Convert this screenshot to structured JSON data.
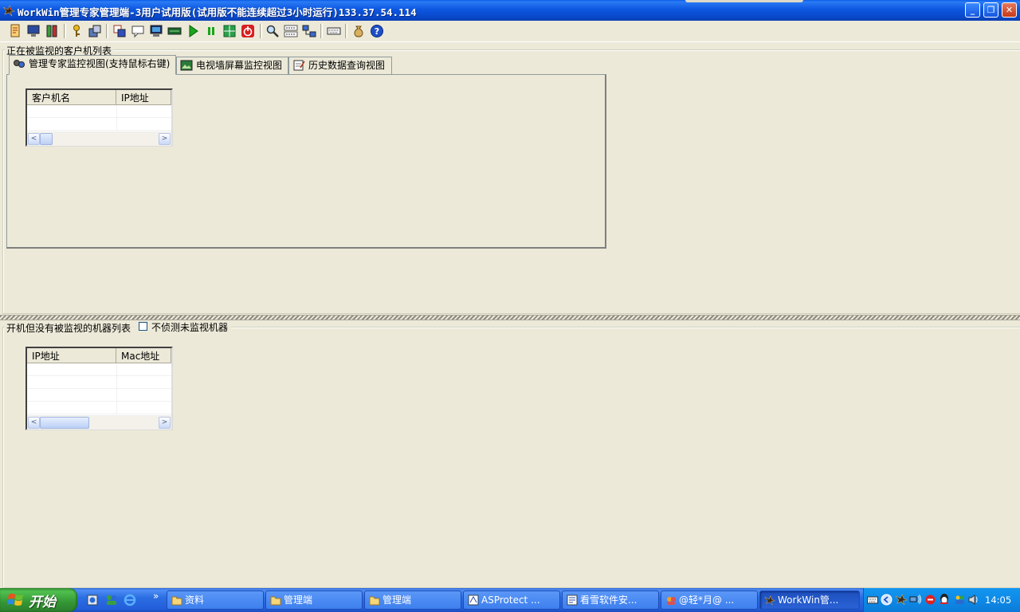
{
  "window": {
    "title": "WorkWin管理专家管理端-3用户试用版(试用版不能连续超过3小时运行)133.37.54.114",
    "controls": {
      "minimize": "_",
      "maximize": "❐",
      "close": "✕"
    }
  },
  "toolbar": {
    "buttons": [
      {
        "icon": "report-icon"
      },
      {
        "icon": "monitor-icon"
      },
      {
        "icon": "users-icon"
      },
      {
        "icon": "key-icon"
      },
      {
        "icon": "settings-icon"
      },
      {
        "icon": "copy-icon"
      },
      {
        "icon": "message-icon"
      },
      {
        "icon": "screen-icon"
      },
      {
        "icon": "device-icon"
      },
      {
        "icon": "play-icon"
      },
      {
        "icon": "pause-icon"
      },
      {
        "icon": "grid-icon"
      },
      {
        "icon": "power-icon"
      },
      {
        "icon": "search-icon"
      },
      {
        "icon": "mac-icon"
      },
      {
        "icon": "network-icon"
      },
      {
        "icon": "keyboard-icon"
      },
      {
        "icon": "money-bag-icon"
      },
      {
        "icon": "help-icon"
      }
    ],
    "colors": {
      "play": "#1aa51a",
      "power": "#d81e1e",
      "help": "#1f4fc7"
    }
  },
  "monitored_group": {
    "label": "正在被监视的客户机列表",
    "tabs": [
      {
        "label": "管理专家监控视图(支持鼠标右键)",
        "icon": "binoculars-icon",
        "active": true
      },
      {
        "label": "电视墙屏幕监控视图",
        "icon": "picture-icon",
        "active": false
      },
      {
        "label": "历史数据查询视图",
        "icon": "notepad-icon",
        "active": false
      }
    ],
    "columns": [
      "客户机名",
      "IP地址"
    ]
  },
  "unmonitored_group": {
    "label": "开机但没有被监视的机器列表",
    "checkbox_label": "不侦测未监视机器",
    "checked": false,
    "columns": [
      "IP地址",
      "Mac地址"
    ]
  },
  "scroll": {
    "left": "<",
    "right": ">"
  },
  "taskbar": {
    "start_label": "开始",
    "more": "»",
    "items": [
      {
        "label": "资料",
        "icon": "folder-icon"
      },
      {
        "label": "管理端",
        "icon": "folder-icon"
      },
      {
        "label": "管理端",
        "icon": "folder-icon"
      },
      {
        "label": "ASProtect ...",
        "icon": "app-icon"
      },
      {
        "label": "看雪软件安...",
        "icon": "app-icon"
      },
      {
        "label": "@轻*月@ ...",
        "icon": "chat-icon"
      },
      {
        "label": "WorkWin管...",
        "icon": "eagle-icon",
        "active": true
      }
    ],
    "clock": "14:05"
  }
}
